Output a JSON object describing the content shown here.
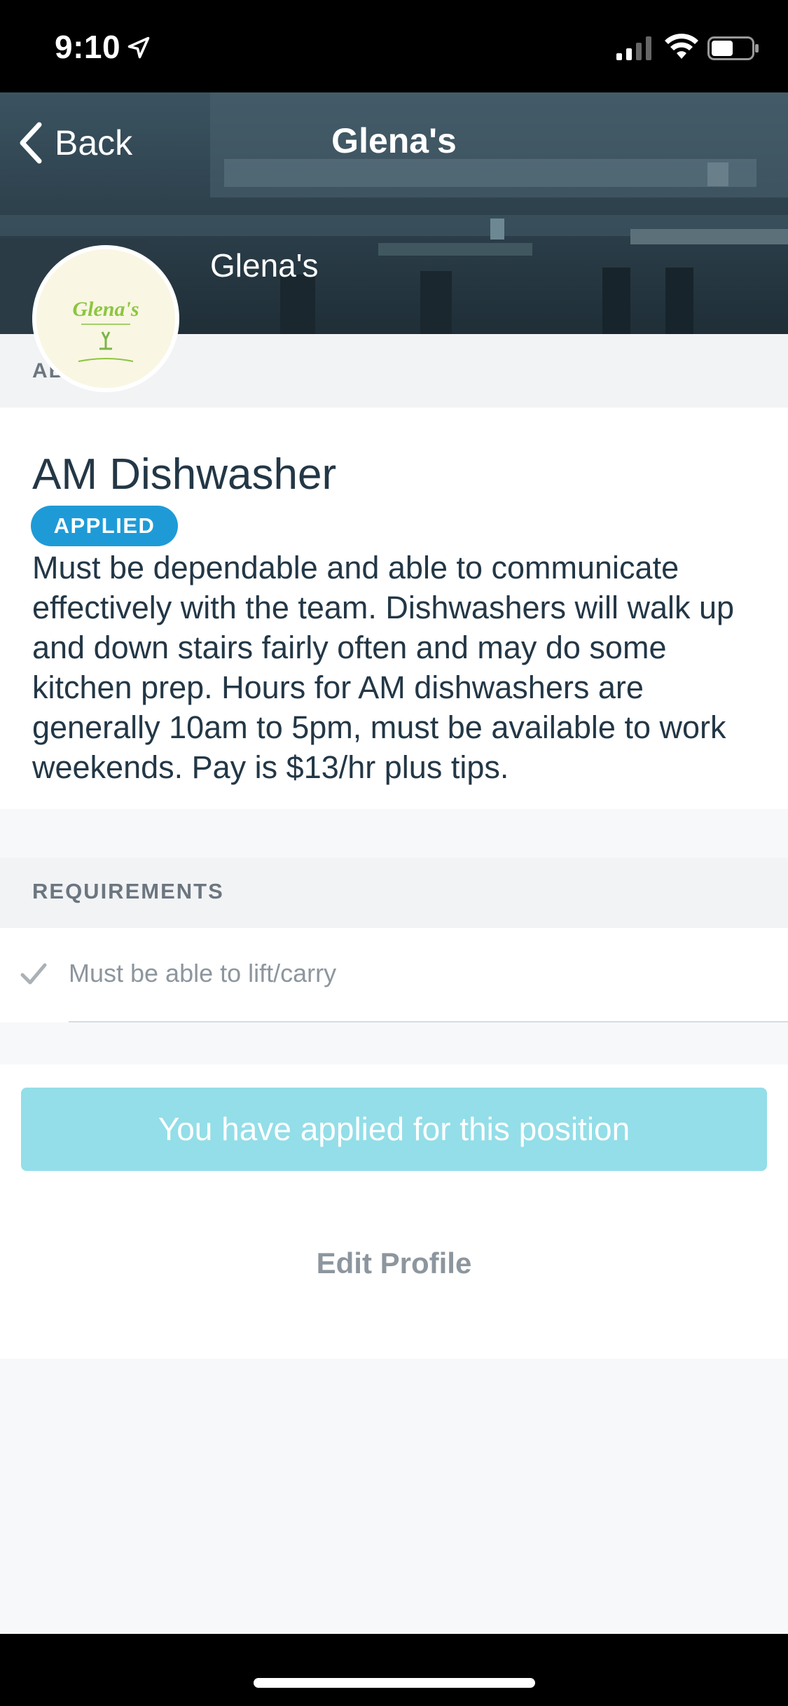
{
  "status_bar": {
    "time": "9:10"
  },
  "nav": {
    "back_label": "Back",
    "title": "Glena's"
  },
  "business": {
    "name": "Glena's",
    "logo_text": "Glena's"
  },
  "about": {
    "label": "AB"
  },
  "job": {
    "title": "AM Dishwasher",
    "status_badge": "APPLIED",
    "description": "Must be dependable and able to communicate effectively with the team. Dishwashers will walk up and down stairs fairly often and may do some kitchen prep. Hours for AM dishwashers are generally 10am to 5pm, must be available to work weekends. Pay is $13/hr plus tips."
  },
  "requirements": {
    "label": "REQUIREMENTS",
    "items": [
      {
        "text": "Must be able to lift/carry",
        "icon": "check-icon"
      }
    ]
  },
  "actions": {
    "applied_button_label": "You have applied for this position",
    "edit_profile_label": "Edit Profile"
  },
  "colors": {
    "accent_blue": "#1e9bd7",
    "applied_button": "#93dee8",
    "text_dark": "#233746",
    "text_muted": "#8d969e"
  }
}
